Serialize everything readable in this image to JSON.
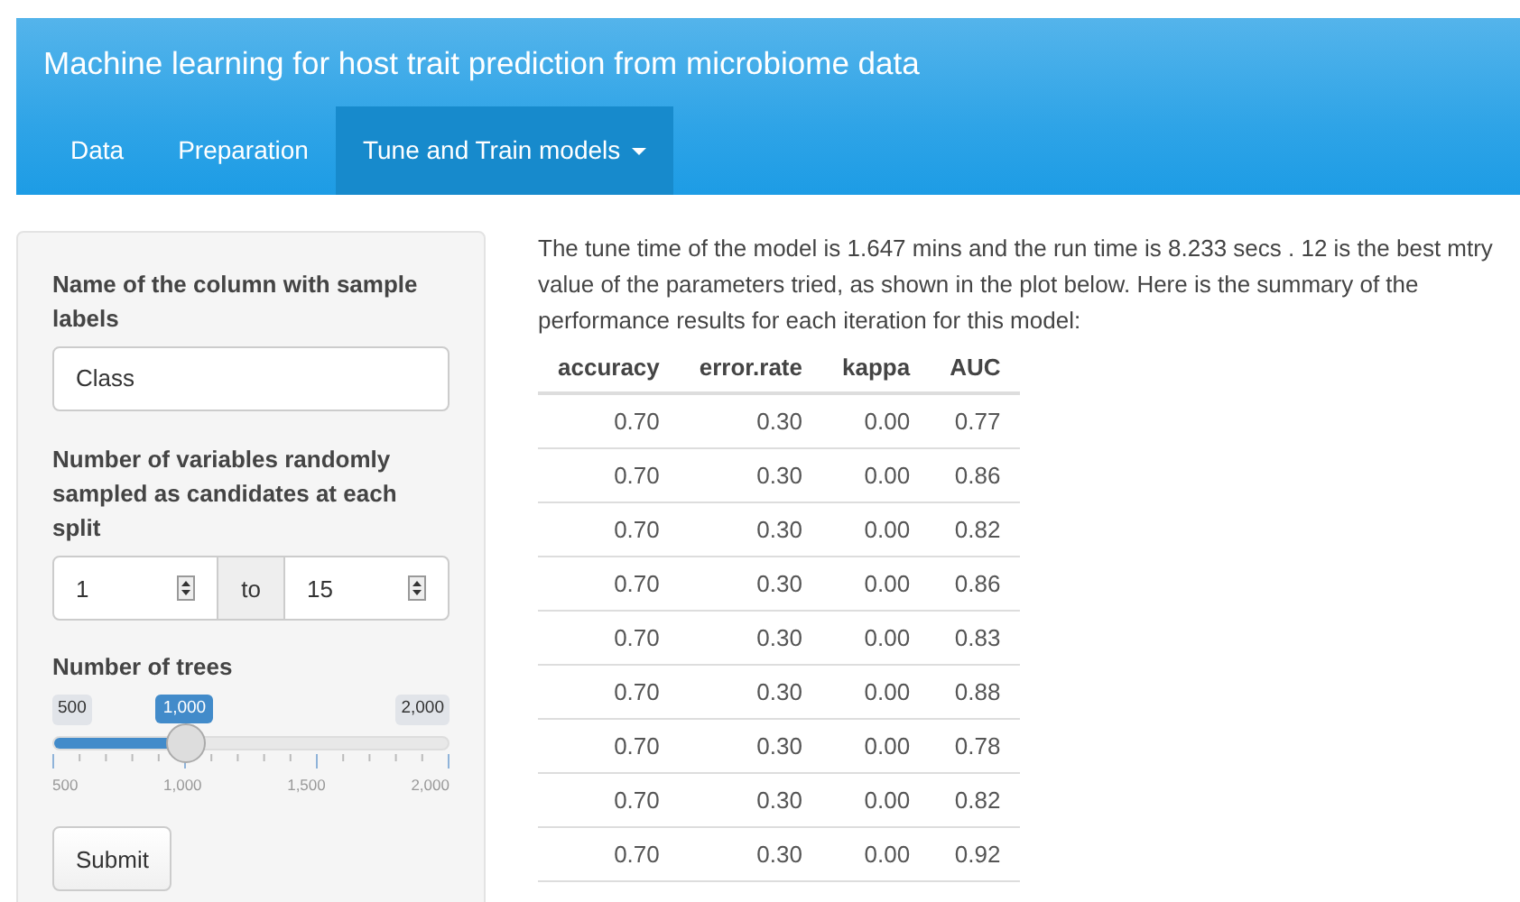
{
  "navbar": {
    "title": "Machine learning for host trait prediction from microbiome data",
    "tabs": [
      {
        "label": "Data",
        "selected": false,
        "dropdown": false
      },
      {
        "label": "Preparation",
        "selected": false,
        "dropdown": false
      },
      {
        "label": "Tune and Train models",
        "selected": true,
        "dropdown": true
      }
    ]
  },
  "sidebar": {
    "label_column": "Name of the column with sample labels",
    "column_value": "Class",
    "label_mtry": "Number of variables randomly sampled as candidates at each split",
    "mtry_from": "1",
    "mtry_sep": "to",
    "mtry_to": "15",
    "label_trees": "Number of trees",
    "slider": {
      "min_label": "500",
      "value_label": "1,000",
      "max_label": "2,000",
      "level": 0.3333,
      "ticks": [
        "500",
        "1,000",
        "1,500",
        "2,000"
      ]
    },
    "submit": "Submit"
  },
  "main": {
    "summary": "The tune time of the model is 1.647 mins and the run time is 8.233 secs . 12 is the best mtry value of the parameters tried, as shown in the plot below. Here is the summary of the performance results for each iteration for this model:",
    "table": {
      "columns": [
        "accuracy",
        "error.rate",
        "kappa",
        "AUC"
      ],
      "rows": [
        [
          "0.70",
          "0.30",
          "0.00",
          "0.77"
        ],
        [
          "0.70",
          "0.30",
          "0.00",
          "0.86"
        ],
        [
          "0.70",
          "0.30",
          "0.00",
          "0.82"
        ],
        [
          "0.70",
          "0.30",
          "0.00",
          "0.86"
        ],
        [
          "0.70",
          "0.30",
          "0.00",
          "0.83"
        ],
        [
          "0.70",
          "0.30",
          "0.00",
          "0.88"
        ],
        [
          "0.70",
          "0.30",
          "0.00",
          "0.78"
        ],
        [
          "0.70",
          "0.30",
          "0.00",
          "0.82"
        ],
        [
          "0.70",
          "0.30",
          "0.00",
          "0.92"
        ]
      ]
    }
  }
}
